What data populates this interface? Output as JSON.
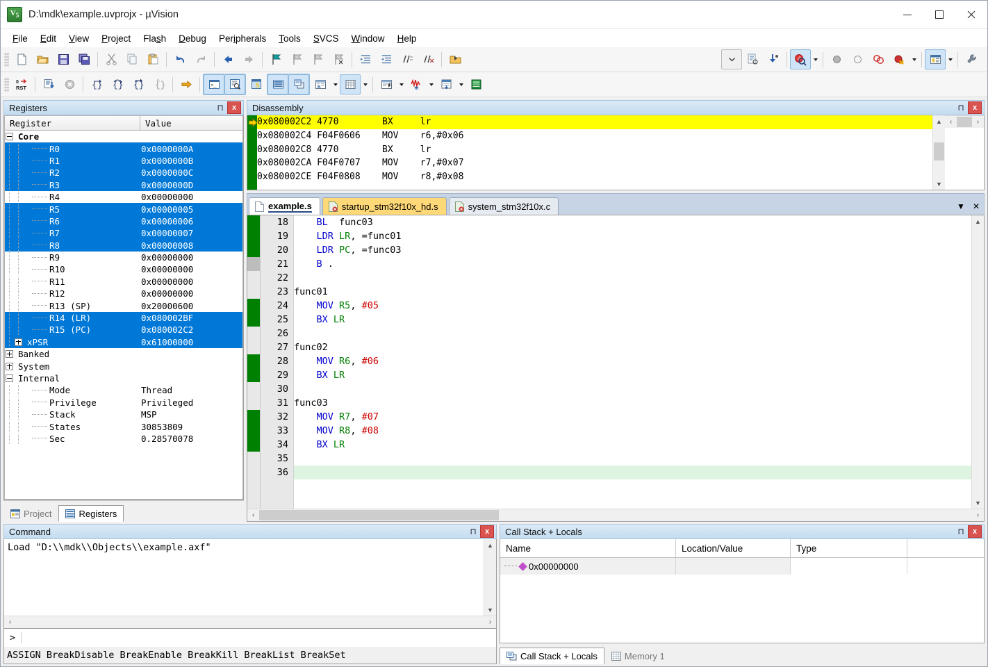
{
  "window": {
    "title": "D:\\mdk\\example.uvprojx - µVision",
    "app_icon": "uvision-logo-icon",
    "controls": {
      "minimize": "—",
      "maximize": "□",
      "close": "✕"
    }
  },
  "menubar": {
    "items": [
      {
        "label": "File",
        "accel": "F"
      },
      {
        "label": "Edit",
        "accel": "E"
      },
      {
        "label": "View",
        "accel": "V"
      },
      {
        "label": "Project",
        "accel": "P"
      },
      {
        "label": "Flash",
        "accel": "s"
      },
      {
        "label": "Debug",
        "accel": "D"
      },
      {
        "label": "Peripherals",
        "accel": "i"
      },
      {
        "label": "Tools",
        "accel": "T"
      },
      {
        "label": "SVCS",
        "accel": "S"
      },
      {
        "label": "Window",
        "accel": "W"
      },
      {
        "label": "Help",
        "accel": "H"
      }
    ]
  },
  "registers_panel": {
    "title": "Registers",
    "columns": [
      "Register",
      "Value"
    ],
    "rows": [
      {
        "label": "Core",
        "value": "",
        "level": 0,
        "twisty": "minus",
        "bold": true,
        "selected": false
      },
      {
        "label": "R0",
        "value": "0x0000000A",
        "level": 2,
        "twisty": "none",
        "selected": true
      },
      {
        "label": "R1",
        "value": "0x0000000B",
        "level": 2,
        "twisty": "none",
        "selected": true
      },
      {
        "label": "R2",
        "value": "0x0000000C",
        "level": 2,
        "twisty": "none",
        "selected": true
      },
      {
        "label": "R3",
        "value": "0x0000000D",
        "level": 2,
        "twisty": "none",
        "selected": true
      },
      {
        "label": "R4",
        "value": "0x00000000",
        "level": 2,
        "twisty": "none",
        "selected": false
      },
      {
        "label": "R5",
        "value": "0x00000005",
        "level": 2,
        "twisty": "none",
        "selected": true
      },
      {
        "label": "R6",
        "value": "0x00000006",
        "level": 2,
        "twisty": "none",
        "selected": true
      },
      {
        "label": "R7",
        "value": "0x00000007",
        "level": 2,
        "twisty": "none",
        "selected": true
      },
      {
        "label": "R8",
        "value": "0x00000008",
        "level": 2,
        "twisty": "none",
        "selected": true
      },
      {
        "label": "R9",
        "value": "0x00000000",
        "level": 2,
        "twisty": "none",
        "selected": false
      },
      {
        "label": "R10",
        "value": "0x00000000",
        "level": 2,
        "twisty": "none",
        "selected": false
      },
      {
        "label": "R11",
        "value": "0x00000000",
        "level": 2,
        "twisty": "none",
        "selected": false
      },
      {
        "label": "R12",
        "value": "0x00000000",
        "level": 2,
        "twisty": "none",
        "selected": false
      },
      {
        "label": "R13 (SP)",
        "value": "0x20000600",
        "level": 2,
        "twisty": "none",
        "selected": false
      },
      {
        "label": "R14 (LR)",
        "value": "0x080002BF",
        "level": 2,
        "twisty": "none",
        "selected": true
      },
      {
        "label": "R15 (PC)",
        "value": "0x080002C2",
        "level": 2,
        "twisty": "none",
        "selected": true
      },
      {
        "label": "xPSR",
        "value": "0x61000000",
        "level": 1,
        "twisty": "plus",
        "selected": true
      },
      {
        "label": "Banked",
        "value": "",
        "level": 0,
        "twisty": "plus",
        "selected": false
      },
      {
        "label": "System",
        "value": "",
        "level": 0,
        "twisty": "plus",
        "selected": false
      },
      {
        "label": "Internal",
        "value": "",
        "level": 0,
        "twisty": "minus",
        "selected": false
      },
      {
        "label": "Mode",
        "value": "Thread",
        "level": 2,
        "twisty": "none",
        "selected": false
      },
      {
        "label": "Privilege",
        "value": "Privileged",
        "level": 2,
        "twisty": "none",
        "selected": false
      },
      {
        "label": "Stack",
        "value": "MSP",
        "level": 2,
        "twisty": "none",
        "selected": false
      },
      {
        "label": "States",
        "value": "30853809",
        "level": 2,
        "twisty": "none",
        "selected": false
      },
      {
        "label": "Sec",
        "value": "0.28570078",
        "level": 2,
        "twisty": "none",
        "selected": false
      }
    ],
    "bottom_tabs": [
      {
        "label": "Project",
        "icon": "project-icon",
        "active": false
      },
      {
        "label": "Registers",
        "icon": "registers-icon",
        "active": true
      }
    ]
  },
  "disassembly_panel": {
    "title": "Disassembly",
    "lines": [
      {
        "address": "0x080002C2",
        "opcode": "4770",
        "mnemonic": "BX",
        "operands": "lr",
        "current": true
      },
      {
        "address": "0x080002C4",
        "opcode": "F04F0606",
        "mnemonic": "MOV",
        "operands": "r6,#0x06",
        "current": false
      },
      {
        "address": "0x080002C8",
        "opcode": "4770",
        "mnemonic": "BX",
        "operands": "lr",
        "current": false
      },
      {
        "address": "0x080002CA",
        "opcode": "F04F0707",
        "mnemonic": "MOV",
        "operands": "r7,#0x07",
        "current": false
      },
      {
        "address": "0x080002CE",
        "opcode": "F04F0808",
        "mnemonic": "MOV",
        "operands": "r8,#0x08",
        "current": false
      }
    ]
  },
  "editor": {
    "tabs": [
      {
        "label": "example.s",
        "state": "active",
        "icon": "document-icon"
      },
      {
        "label": "startup_stm32f10x_hd.s",
        "state": "modified",
        "icon": "document-error-icon"
      },
      {
        "label": "system_stm32f10x.c",
        "state": "plain",
        "icon": "document-error-icon"
      }
    ],
    "lines": [
      {
        "num": "18",
        "coverage": "green",
        "current": false,
        "tokens": [
          {
            "t": "    ",
            "c": "lb"
          },
          {
            "t": "BL",
            "c": "mn"
          },
          {
            "t": "  ",
            "c": "lb"
          },
          {
            "t": "func03",
            "c": "lb"
          }
        ]
      },
      {
        "num": "19",
        "coverage": "green",
        "current": false,
        "tokens": [
          {
            "t": "    ",
            "c": "lb"
          },
          {
            "t": "LDR",
            "c": "mn"
          },
          {
            "t": " ",
            "c": "lb"
          },
          {
            "t": "LR",
            "c": "rg"
          },
          {
            "t": ", =func01",
            "c": "lb"
          }
        ]
      },
      {
        "num": "20",
        "coverage": "green",
        "current": false,
        "tokens": [
          {
            "t": "    ",
            "c": "lb"
          },
          {
            "t": "LDR",
            "c": "mn"
          },
          {
            "t": " ",
            "c": "lb"
          },
          {
            "t": "PC",
            "c": "rg"
          },
          {
            "t": ", =func03",
            "c": "lb"
          }
        ]
      },
      {
        "num": "21",
        "coverage": "gray",
        "current": false,
        "tokens": [
          {
            "t": "    ",
            "c": "lb"
          },
          {
            "t": "B",
            "c": "mn"
          },
          {
            "t": " .",
            "c": "lb"
          }
        ]
      },
      {
        "num": "22",
        "coverage": "none",
        "current": false,
        "tokens": []
      },
      {
        "num": "23",
        "coverage": "none",
        "current": false,
        "tokens": [
          {
            "t": "func01",
            "c": "lb"
          }
        ]
      },
      {
        "num": "24",
        "coverage": "green",
        "current": false,
        "tokens": [
          {
            "t": "    ",
            "c": "lb"
          },
          {
            "t": "MOV",
            "c": "mn"
          },
          {
            "t": " ",
            "c": "lb"
          },
          {
            "t": "R5",
            "c": "rg"
          },
          {
            "t": ", ",
            "c": "lb"
          },
          {
            "t": "#05",
            "c": "im"
          }
        ]
      },
      {
        "num": "25",
        "coverage": "green",
        "current": false,
        "tokens": [
          {
            "t": "    ",
            "c": "lb"
          },
          {
            "t": "BX",
            "c": "mn"
          },
          {
            "t": " ",
            "c": "lb"
          },
          {
            "t": "LR",
            "c": "rg"
          }
        ]
      },
      {
        "num": "26",
        "coverage": "none",
        "current": false,
        "tokens": []
      },
      {
        "num": "27",
        "coverage": "none",
        "current": false,
        "tokens": [
          {
            "t": "func02",
            "c": "lb"
          }
        ]
      },
      {
        "num": "28",
        "coverage": "green",
        "current": false,
        "tokens": [
          {
            "t": "    ",
            "c": "lb"
          },
          {
            "t": "MOV",
            "c": "mn"
          },
          {
            "t": " ",
            "c": "lb"
          },
          {
            "t": "R6",
            "c": "rg"
          },
          {
            "t": ", ",
            "c": "lb"
          },
          {
            "t": "#06",
            "c": "im"
          }
        ]
      },
      {
        "num": "29",
        "coverage": "green",
        "current": false,
        "tokens": [
          {
            "t": "    ",
            "c": "lb"
          },
          {
            "t": "BX",
            "c": "mn"
          },
          {
            "t": " ",
            "c": "lb"
          },
          {
            "t": "LR",
            "c": "rg"
          }
        ]
      },
      {
        "num": "30",
        "coverage": "none",
        "current": false,
        "tokens": []
      },
      {
        "num": "31",
        "coverage": "none",
        "current": false,
        "tokens": [
          {
            "t": "func03",
            "c": "lb"
          }
        ]
      },
      {
        "num": "32",
        "coverage": "green",
        "current": false,
        "tokens": [
          {
            "t": "    ",
            "c": "lb"
          },
          {
            "t": "MOV",
            "c": "mn"
          },
          {
            "t": " ",
            "c": "lb"
          },
          {
            "t": "R7",
            "c": "rg"
          },
          {
            "t": ", ",
            "c": "lb"
          },
          {
            "t": "#07",
            "c": "im"
          }
        ]
      },
      {
        "num": "33",
        "coverage": "green",
        "current": false,
        "tokens": [
          {
            "t": "    ",
            "c": "lb"
          },
          {
            "t": "MOV",
            "c": "mn"
          },
          {
            "t": " ",
            "c": "lb"
          },
          {
            "t": "R8",
            "c": "rg"
          },
          {
            "t": ", ",
            "c": "lb"
          },
          {
            "t": "#08",
            "c": "im"
          }
        ]
      },
      {
        "num": "34",
        "coverage": "green",
        "current": false,
        "tokens": [
          {
            "t": "    ",
            "c": "lb"
          },
          {
            "t": "BX",
            "c": "mn"
          },
          {
            "t": " ",
            "c": "lb"
          },
          {
            "t": "LR",
            "c": "rg"
          }
        ]
      },
      {
        "num": "35",
        "coverage": "none",
        "current": false,
        "tokens": []
      },
      {
        "num": "36",
        "coverage": "none",
        "current": true,
        "tokens": []
      }
    ]
  },
  "command_panel": {
    "title": "Command",
    "output": "Load \"D:\\\\mdk\\\\Objects\\\\example.axf\"",
    "prompt": ">",
    "input_value": "",
    "help_line": "ASSIGN BreakDisable BreakEnable BreakKill BreakList BreakSet"
  },
  "callstack_panel": {
    "title": "Call Stack + Locals",
    "columns": [
      "Name",
      "Location/Value",
      "Type"
    ],
    "rows": [
      {
        "name": "0x00000000",
        "location": "",
        "type": ""
      }
    ],
    "tabs": [
      {
        "label": "Call Stack + Locals",
        "icon": "callstack-icon",
        "active": true
      },
      {
        "label": "Memory 1",
        "icon": "memory-icon",
        "active": false
      }
    ]
  },
  "colors": {
    "selection_blue": "#0078d7",
    "pc_highlight": "#ffff00",
    "coverage_green": "#008000",
    "current_line": "#ddf5e0",
    "panel_title": "#c3dcf0"
  }
}
